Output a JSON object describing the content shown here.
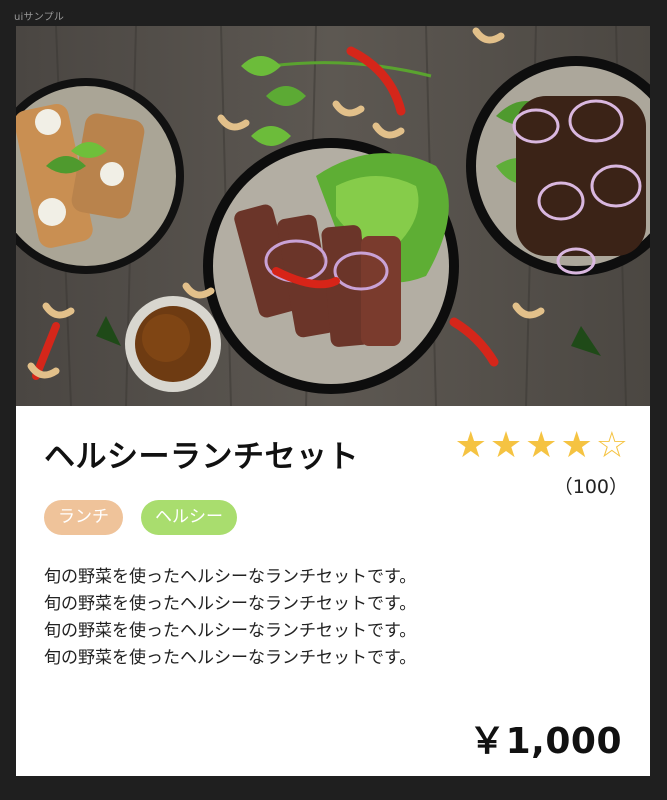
{
  "frame": {
    "label": "uiサンプル"
  },
  "card": {
    "image_alt": "料理の写真",
    "title": "ヘルシーランチセット",
    "rating": {
      "value": 4,
      "max": 5,
      "count_text": "（100）"
    },
    "tags": [
      {
        "label": "ランチ",
        "color": "#efc39a"
      },
      {
        "label": "ヘルシー",
        "color": "#a9dd6e"
      }
    ],
    "description_lines": [
      "旬の野菜を使ったヘルシーなランチセットです。",
      "旬の野菜を使ったヘルシーなランチセットです。",
      "旬の野菜を使ったヘルシーなランチセットです。",
      "旬の野菜を使ったヘルシーなランチセットです。"
    ],
    "price": "￥1,000"
  },
  "colors": {
    "background": "#1f1f1f",
    "card": "#ffffff",
    "star": "#f5c342"
  }
}
